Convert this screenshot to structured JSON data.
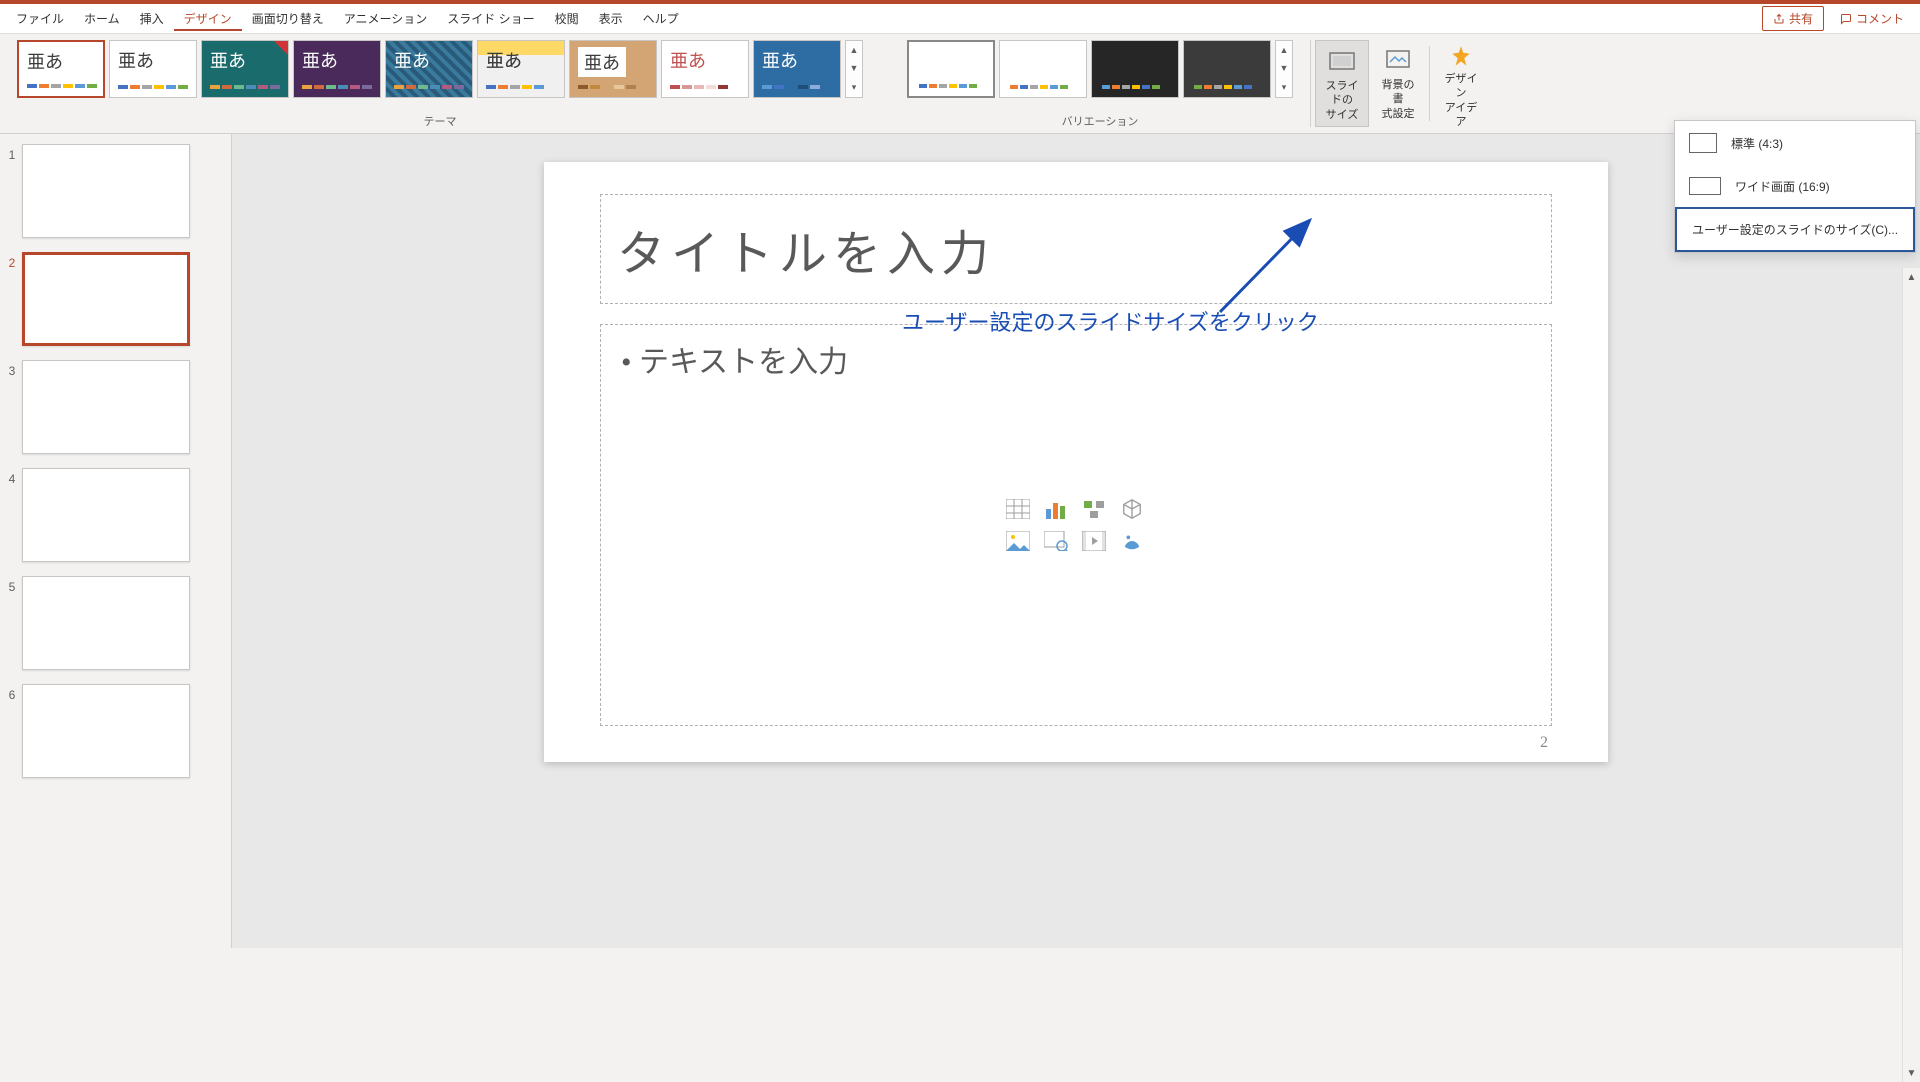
{
  "menu": {
    "items": [
      "ファイル",
      "ホーム",
      "挿入",
      "デザイン",
      "画面切り替え",
      "アニメーション",
      "スライド ショー",
      "校閲",
      "表示",
      "ヘルプ"
    ],
    "active_index": 3,
    "share": "共有",
    "comment": "コメント"
  },
  "ribbon": {
    "themes_label": "テーマ",
    "variations_label": "バリエーション",
    "theme_text": "亜あ",
    "slide_size": "スライドの\nサイズ",
    "background_format": "背景の書\n式設定",
    "design_ideas": "デザイン\nアイデア",
    "themes": [
      {
        "bg": "#ffffff",
        "fg": "#3b3b3b",
        "bars": [
          "#4472c4",
          "#ed7d31",
          "#a5a5a5",
          "#ffc000",
          "#5b9bd5",
          "#70ad47"
        ],
        "selected": true
      },
      {
        "bg": "#ffffff",
        "fg": "#3b3b3b",
        "bars": [
          "#4472c4",
          "#ed7d31",
          "#a5a5a5",
          "#ffc000",
          "#5b9bd5",
          "#70ad47"
        ]
      },
      {
        "bg": "#1a6b6b",
        "fg": "#ffffff",
        "bars": [
          "#e8a33d",
          "#d16b3e",
          "#6fb98f",
          "#4a8db7",
          "#b45a7e",
          "#7b6a9e"
        ],
        "corner": "#d13438"
      },
      {
        "bg": "#4a2a5a",
        "fg": "#ffffff",
        "bars": [
          "#e8a33d",
          "#d16b3e",
          "#6fb98f",
          "#4a8db7",
          "#b45a7e",
          "#7b6a9e"
        ]
      },
      {
        "bg": "#3a7a9c",
        "fg": "#ffffff",
        "bars": [
          "#e8a33d",
          "#d16b3e",
          "#6fb98f",
          "#4a8db7",
          "#b45a7e",
          "#7b6a9e"
        ],
        "pattern": true
      },
      {
        "bg": "#f0f0f0",
        "fg": "#3b3b3b",
        "bars": [
          "#4472c4",
          "#ed7d31",
          "#a5a5a5",
          "#ffc000",
          "#5b9bd5"
        ],
        "stripe": "#ffd966"
      },
      {
        "bg": "#d4a574",
        "fg": "#3b3b3b",
        "bars": [
          "#8b5a2b",
          "#c28840",
          "#d4a574",
          "#e8c89a",
          "#b08050"
        ],
        "boxed": true
      },
      {
        "bg": "#ffffff",
        "fg": "#c0504d",
        "bars": [
          "#c0504d",
          "#d99694",
          "#e6b9b8",
          "#f2dcdb",
          "#963634"
        ]
      },
      {
        "bg": "#2e6da4",
        "fg": "#ffffff",
        "bars": [
          "#5b9bd5",
          "#4472c4",
          "#2e6da4",
          "#1f4e79",
          "#8faadc"
        ]
      }
    ],
    "variations": [
      {
        "bg": "#ffffff",
        "accent": "#4472c4",
        "bars": [
          "#4472c4",
          "#ed7d31",
          "#a5a5a5",
          "#ffc000",
          "#5b9bd5",
          "#70ad47"
        ],
        "selected": true
      },
      {
        "bg": "#ffffff",
        "accent": "#ed7d31",
        "bars": [
          "#ed7d31",
          "#4472c4",
          "#a5a5a5",
          "#ffc000",
          "#5b9bd5",
          "#70ad47"
        ]
      },
      {
        "bg": "#262626",
        "accent": "#5b9bd5",
        "bars": [
          "#5b9bd5",
          "#ed7d31",
          "#a5a5a5",
          "#ffc000",
          "#4472c4",
          "#70ad47"
        ]
      },
      {
        "bg": "#3b3b3b",
        "accent": "#70ad47",
        "bars": [
          "#70ad47",
          "#ed7d31",
          "#a5a5a5",
          "#ffc000",
          "#5b9bd5",
          "#4472c4"
        ]
      }
    ]
  },
  "dropdown": {
    "standard": "標準 (4:3)",
    "wide": "ワイド画面 (16:9)",
    "custom": "ユーザー設定のスライドのサイズ(C)..."
  },
  "slides": {
    "count": 6,
    "selected_index": 2
  },
  "canvas": {
    "title_placeholder": "タイトルを入力",
    "body_placeholder": "• テキストを入力",
    "page_number": "2"
  },
  "annotation": {
    "text": "ユーザー設定のスライドサイズをクリック"
  }
}
